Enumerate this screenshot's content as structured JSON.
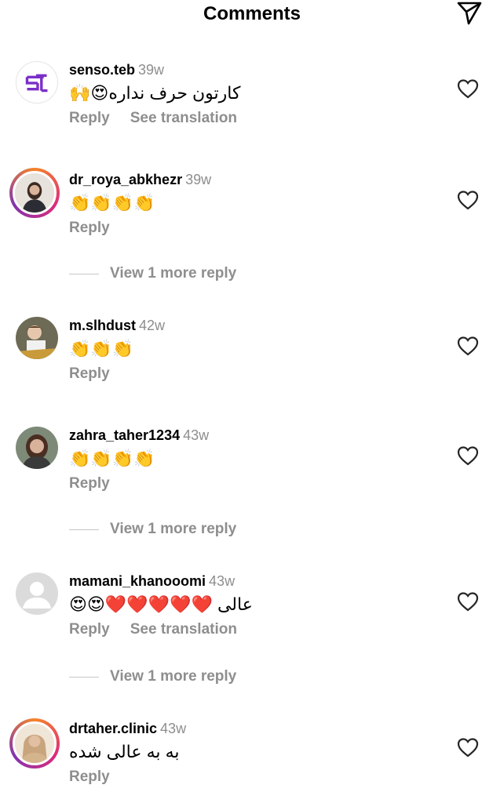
{
  "header": {
    "title": "Comments"
  },
  "comments": [
    {
      "username": "senso.teb",
      "time": "39w",
      "text": "کارتون حرف نداره😍🙌",
      "reply": "Reply",
      "translate": "See translation"
    },
    {
      "username": "dr_roya_abkhezr",
      "time": "39w",
      "text": "👏👏👏👏",
      "reply": "Reply",
      "more": "View 1 more reply"
    },
    {
      "username": "m.slhdust",
      "time": "42w",
      "text": "👏👏👏",
      "reply": "Reply"
    },
    {
      "username": "zahra_taher1234",
      "time": "43w",
      "text": "👏👏👏👏",
      "reply": "Reply",
      "more": "View 1 more reply"
    },
    {
      "username": "mamani_khanooomi",
      "time": "43w",
      "text": "عالی ❤️❤️❤️❤️❤️😍😍",
      "reply": "Reply",
      "translate": "See translation",
      "more": "View 1 more reply"
    },
    {
      "username": "drtaher.clinic",
      "time": "43w",
      "text": "به به عالی شده",
      "reply": "Reply"
    }
  ],
  "icons": {
    "send": "paper-plane-icon",
    "like": "heart-outline-icon"
  },
  "colors": {
    "secondary_text": "#8e8e8e",
    "story_ring": "#dd2a7b",
    "brand_logo": "#7b2fc9"
  }
}
